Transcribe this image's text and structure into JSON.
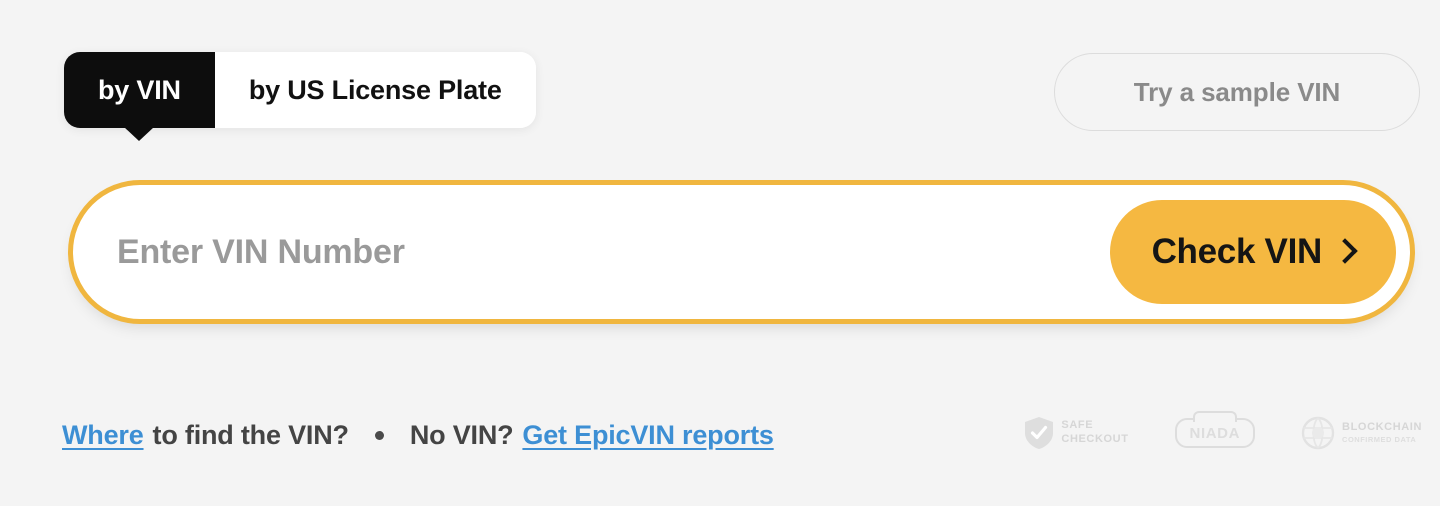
{
  "tabs": [
    {
      "label": "by VIN",
      "active": true,
      "name": "tab-by-vin"
    },
    {
      "label": "by US License Plate",
      "active": false,
      "name": "tab-by-us-license-plate"
    }
  ],
  "sample_button": {
    "label": "Try a sample VIN"
  },
  "search": {
    "placeholder": "Enter VIN Number",
    "value": "",
    "submit_label": "Check VIN",
    "submit_icon": "chevron-right-icon"
  },
  "footer": {
    "link_where": "Where",
    "text_to_find": "to find the VIN?",
    "separator": "•",
    "text_no_vin": "No VIN?",
    "link_reports": "Get EpicVIN reports"
  },
  "badges": [
    {
      "icon": "shield-check-icon",
      "line1": "SAFE",
      "line2": "CHECKOUT"
    },
    {
      "icon": "niada-logo-icon",
      "line1": "NIADA",
      "line2": ""
    },
    {
      "icon": "blockchain-globe-icon",
      "line1": "BLOCKCHAIN",
      "line2": "CONFIRMED DATA"
    }
  ],
  "colors": {
    "page_background": "#f4f4f4",
    "accent_amber": "#f5b841",
    "border_amber": "#f0b63f",
    "tab_active_background": "#0d0d0d",
    "link_blue": "#3d8fd4",
    "muted_gray": "#8a8a8a",
    "badge_gray": "#dddddd"
  }
}
